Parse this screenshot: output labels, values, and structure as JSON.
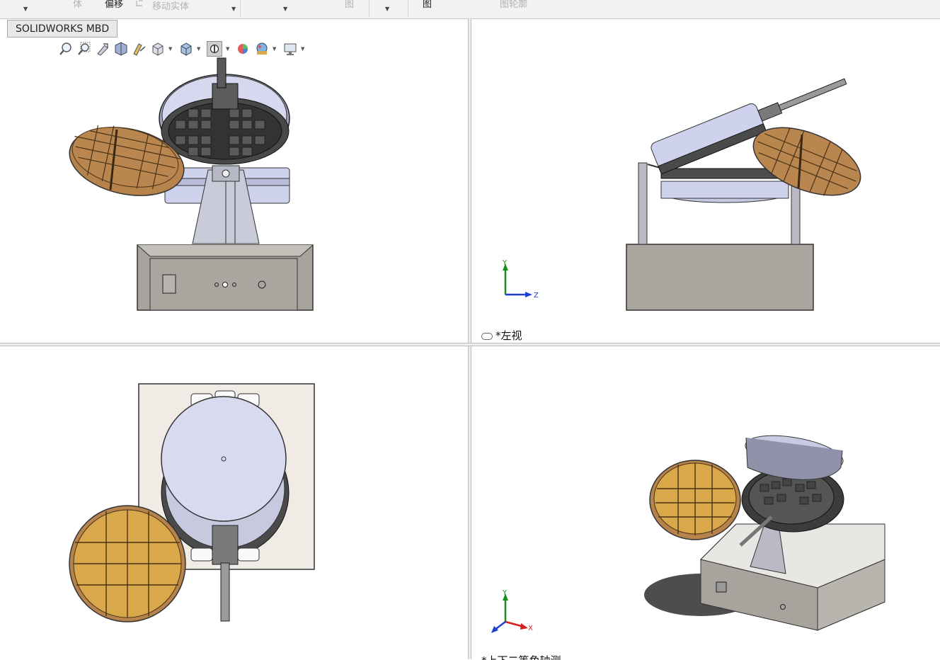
{
  "ribbon": {
    "items": [
      "体",
      "偏移",
      "移动实体",
      "图",
      "图",
      "图轮廓"
    ]
  },
  "tab": {
    "label": "SOLIDWORKS MBD"
  },
  "toolbar": {
    "icons": [
      "zoom-to-fit-icon",
      "zoom-to-area-icon",
      "previous-view-icon",
      "section-view-icon",
      "dynamic-annotation-icon",
      "view-orientation-icon",
      "display-style-icon",
      "hide-show-items-icon",
      "edit-appearance-icon",
      "apply-scene-icon",
      "view-settings-icon"
    ]
  },
  "views": {
    "top_left": {
      "name": "front-view"
    },
    "top_right": {
      "label": "*左视",
      "triad": {
        "y": "Y",
        "z": "Z"
      }
    },
    "bottom_left": {
      "name": "top-view"
    },
    "bottom_right": {
      "label": "*上下二等角轴测",
      "triad": {
        "y": "Y",
        "x": "X"
      }
    }
  },
  "colors": {
    "waffle": "#b8864e",
    "waffle_light": "#d9a84a",
    "metal": "#a8a9ad",
    "plate": "#cfd2ec",
    "dark": "#3c3c3c",
    "base": "#a9a59f",
    "axis_y": "#1a8c1a",
    "axis_z": "#1f3fcf",
    "axis_x": "#d01f1f"
  }
}
